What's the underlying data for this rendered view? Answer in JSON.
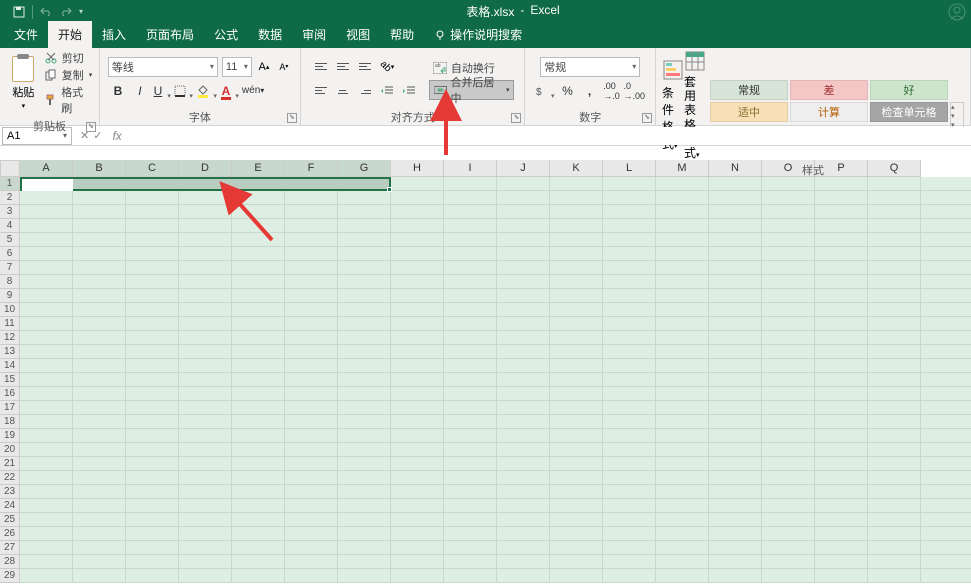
{
  "titlebar": {
    "filename": "表格.xlsx",
    "app": "Excel"
  },
  "tabs": {
    "file": "文件",
    "home": "开始",
    "insert": "插入",
    "pagelayout": "页面布局",
    "formulas": "公式",
    "data": "数据",
    "review": "审阅",
    "view": "视图",
    "help": "帮助",
    "tellme": "操作说明搜索"
  },
  "clipboard": {
    "paste": "粘贴",
    "cut": "剪切",
    "copy": "复制",
    "painter": "格式刷",
    "group": "剪贴板"
  },
  "font": {
    "name": "等线",
    "size": "11",
    "group": "字体",
    "bold": "B",
    "italic": "I",
    "underline": "U"
  },
  "alignment": {
    "wrap": "自动换行",
    "merge": "合并后居中",
    "group": "对齐方式"
  },
  "number": {
    "format": "常规",
    "group": "数字"
  },
  "styles": {
    "conditional": "条件格式",
    "table": "套用\n表格格式",
    "normal": "常规",
    "bad": "差",
    "good": "好",
    "neutral": "适中",
    "calc": "计算",
    "check": "检查单元格",
    "group": "样式"
  },
  "namebox": "A1",
  "columns": [
    "A",
    "B",
    "C",
    "D",
    "E",
    "F",
    "G",
    "H",
    "I",
    "J",
    "K",
    "L",
    "M",
    "N",
    "O",
    "P",
    "Q"
  ],
  "rows": [
    "1",
    "2",
    "3",
    "4",
    "5",
    "6",
    "7",
    "8",
    "9",
    "10",
    "11",
    "12",
    "13",
    "14",
    "15",
    "16",
    "17",
    "18",
    "19",
    "20",
    "21",
    "22",
    "23",
    "24",
    "25",
    "26",
    "27",
    "28",
    "29"
  ],
  "selected_cols": 7
}
